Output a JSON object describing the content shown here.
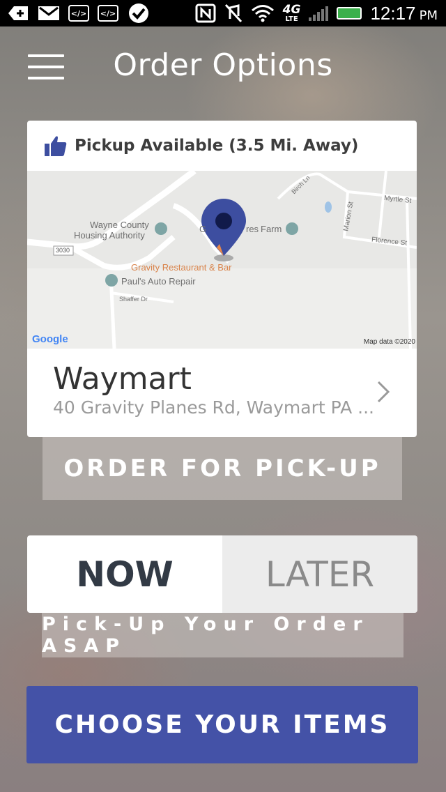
{
  "status_bar": {
    "time": "12:17",
    "ampm": "PM",
    "network": "4G",
    "network_sub": "LTE"
  },
  "header": {
    "title": "Order Options"
  },
  "card": {
    "availability": "Pickup Available (3.5 Mi. Away)",
    "map": {
      "labels": {
        "wayne_county_1": "Wayne County",
        "wayne_county_2": "Housing Authority",
        "restaurant": "Gravity Restaurant & Bar",
        "auto_repair": "Paul's Auto Repair",
        "shaffer": "Shaffer Dr",
        "birch": "Birch Ln",
        "myrtle": "Myrtle St",
        "marion": "Marion St",
        "florence": "Florence St",
        "road_3030": "3030",
        "farm": "Farm",
        "farm_prefix": "G",
        "farm_mid": "res",
        "google": "Google",
        "map_data": "Map data ©2020"
      }
    },
    "location_name": "Waymart",
    "location_address": "40 Gravity Planes Rd, Waymart PA ..."
  },
  "pickup_button": "ORDER FOR PICK-UP",
  "timing": {
    "now": "NOW",
    "later": "LATER",
    "description": "Pick-Up Your Order ASAP"
  },
  "choose_button": "CHOOSE YOUR ITEMS",
  "colors": {
    "accent": "#4452a7",
    "pin": "#3d4ea0",
    "thumb": "#3d4ea0"
  }
}
